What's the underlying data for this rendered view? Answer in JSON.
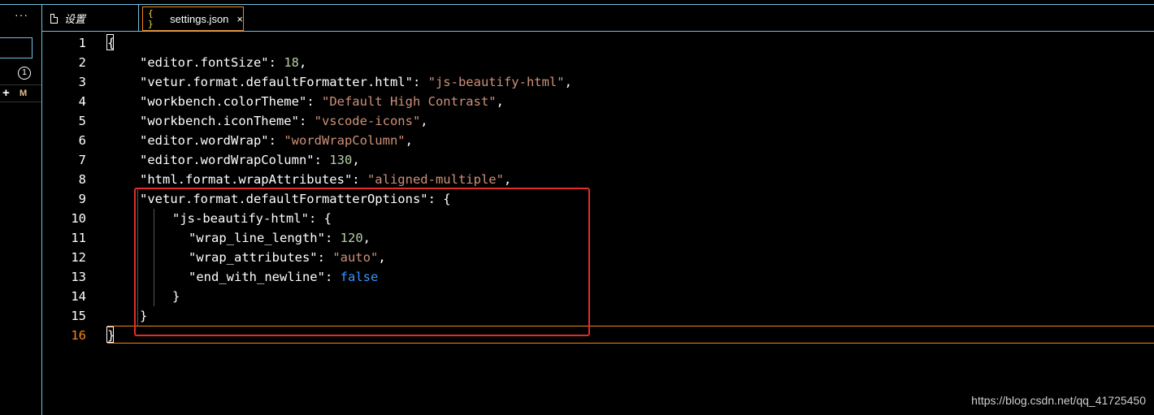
{
  "sidebar": {
    "more_label": "···",
    "badge_count": "1",
    "row_plus": "+",
    "row_status": "M"
  },
  "tabs": [
    {
      "label": "设置"
    },
    {
      "icon": "{ }",
      "label": "settings.json",
      "close": "×"
    }
  ],
  "editor": {
    "lines": [
      {
        "num": "1",
        "text": "{"
      },
      {
        "num": "2",
        "key": "\"editor.fontSize\"",
        "value": "18",
        "vtype": "number",
        "tail": ","
      },
      {
        "num": "3",
        "key": "\"vetur.format.defaultFormatter.html\"",
        "value": "\"js-beautify-html\"",
        "vtype": "string",
        "tail": ","
      },
      {
        "num": "4",
        "key": "\"workbench.colorTheme\"",
        "value": "\"Default High Contrast\"",
        "vtype": "string",
        "tail": ","
      },
      {
        "num": "5",
        "key": "\"workbench.iconTheme\"",
        "value": "\"vscode-icons\"",
        "vtype": "string",
        "tail": ","
      },
      {
        "num": "6",
        "key": "\"editor.wordWrap\"",
        "value": "\"wordWrapColumn\"",
        "vtype": "string",
        "tail": ","
      },
      {
        "num": "7",
        "key": "\"editor.wordWrapColumn\"",
        "value": "130",
        "vtype": "number",
        "tail": ","
      },
      {
        "num": "8",
        "key": "\"html.format.wrapAttributes\"",
        "value": "\"aligned-multiple\"",
        "vtype": "string",
        "tail": ","
      },
      {
        "num": "9",
        "key": "\"vetur.format.defaultFormatterOptions\"",
        "value": "{",
        "vtype": "punct",
        "tail": ""
      },
      {
        "num": "10",
        "key": "\"js-beautify-html\"",
        "value": "{",
        "vtype": "punct",
        "tail": ""
      },
      {
        "num": "11",
        "key": "\"wrap_line_length\"",
        "value": "120",
        "vtype": "number",
        "tail": ","
      },
      {
        "num": "12",
        "key": "\"wrap_attributes\"",
        "value": "\"auto\"",
        "vtype": "string",
        "tail": ","
      },
      {
        "num": "13",
        "key": "\"end_with_newline\"",
        "value": "false",
        "vtype": "bool",
        "tail": ""
      },
      {
        "num": "14",
        "text": "}"
      },
      {
        "num": "15",
        "text": "}"
      },
      {
        "num": "16",
        "text": "}"
      }
    ],
    "active_line": "16"
  },
  "colors": {
    "string": "#ce9178",
    "number": "#b5cea8",
    "keyword": "#3794ff",
    "border": "#6fc3df",
    "active": "#f38518",
    "annotation": "#e32b2b"
  },
  "watermark": "https://blog.csdn.net/qq_41725450"
}
